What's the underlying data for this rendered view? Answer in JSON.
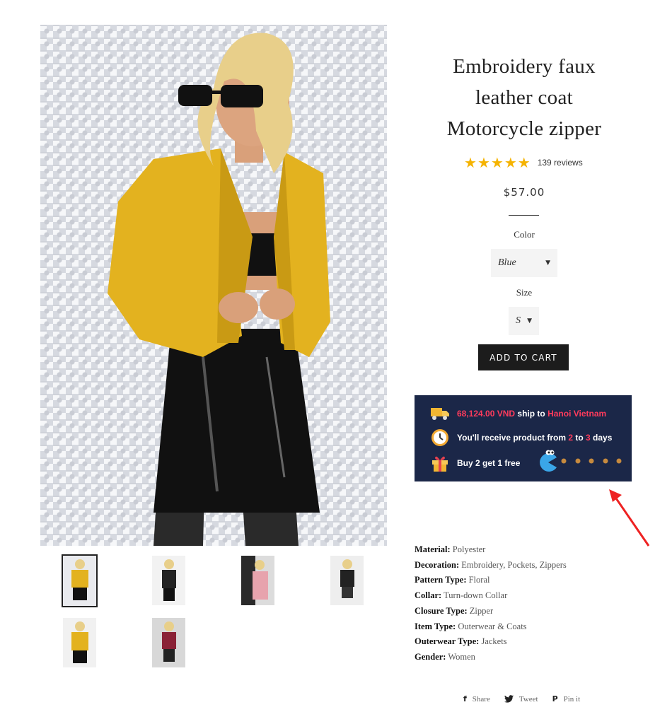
{
  "product": {
    "title_lines": [
      "Embroidery faux",
      "leather coat",
      "Motorcycle zipper"
    ],
    "rating_stars": 5,
    "reviews_label": "139 reviews",
    "price": "$57.00"
  },
  "options": {
    "color_label": "Color",
    "color_value": "Blue",
    "size_label": "Size",
    "size_value": "S"
  },
  "cart": {
    "button_label": "ADD TO CART"
  },
  "shipping": {
    "amount": "68,124.00 VND",
    "ship_to": " ship to ",
    "destination": "Hanoi Vietnam",
    "receive_prefix": "You'll receive product from ",
    "days_from": "2",
    "to_word": " to ",
    "days_to": "3",
    "days_suffix": " days",
    "promo": "Buy 2 get 1 free"
  },
  "specs": [
    {
      "key": "Material:",
      "value": "Polyester"
    },
    {
      "key": "Decoration:",
      "value": "Embroidery, Pockets, Zippers"
    },
    {
      "key": "Pattern Type:",
      "value": "Floral"
    },
    {
      "key": "Collar:",
      "value": "Turn-down Collar"
    },
    {
      "key": "Closure Type:",
      "value": "Zipper"
    },
    {
      "key": "Item Type:",
      "value": "Outerwear & Coats"
    },
    {
      "key": "Outerwear Type:",
      "value": "Jackets"
    },
    {
      "key": "Gender:",
      "value": "Women"
    }
  ],
  "share": {
    "facebook": "Share",
    "twitter": "Tweet",
    "pinterest": "Pin it"
  },
  "colors": {
    "accent_red": "#ff3b5c",
    "ship_bg": "#1b2748",
    "star": "#f5b301",
    "jacket": "#e3b21f"
  },
  "icons": [
    "truck-icon",
    "clock-icon",
    "gift-icon",
    "pacman-icon",
    "facebook-icon",
    "twitter-icon",
    "pinterest-icon",
    "chevron-down-icon"
  ]
}
